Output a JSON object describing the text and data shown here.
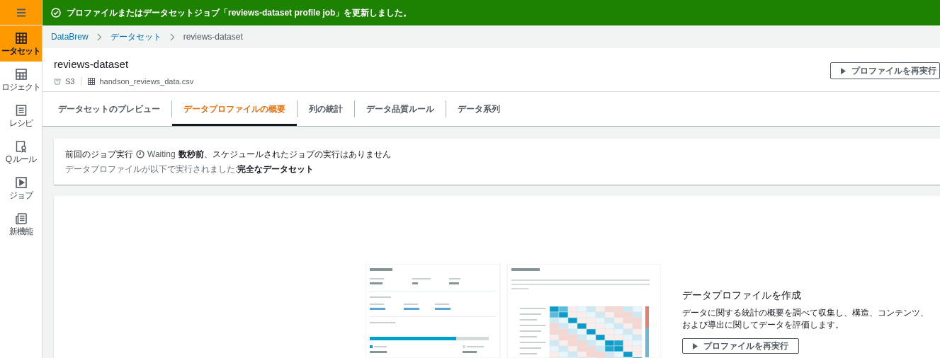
{
  "sidebar": {
    "items": [
      {
        "label": "ータセット",
        "selected": true
      },
      {
        "label": "ロジェクト",
        "selected": false
      },
      {
        "label": "レシピ",
        "selected": false
      },
      {
        "label": "Q ルール",
        "selected": false
      },
      {
        "label": "ジョブ",
        "selected": false
      },
      {
        "label": "新機能",
        "selected": false
      }
    ]
  },
  "flash": {
    "kind": "success",
    "message": "プロファイルまたはデータセットジョブ「reviews-dataset profile job」を更新しました。"
  },
  "breadcrumbs": [
    {
      "label": "DataBrew",
      "link": true
    },
    {
      "label": "データセット",
      "link": true
    },
    {
      "label": "reviews-dataset",
      "link": false
    }
  ],
  "header": {
    "title": "reviews-dataset",
    "source": "S3",
    "file": "handson_reviews_data.csv",
    "action": "プロファイルを再実行"
  },
  "tabs": [
    {
      "label": "データセットのプレビュー",
      "selected": false
    },
    {
      "label": "データプロファイルの概要",
      "selected": true
    },
    {
      "label": "列の統計",
      "selected": false
    },
    {
      "label": "データ品質ルール",
      "selected": false
    },
    {
      "label": "データ系列",
      "selected": false
    }
  ],
  "job_info": {
    "prefix": "前回のジョブ実行",
    "status": "Waiting",
    "time": "数秒前",
    "suffix": "、スケジュールされたジョブの実行はありません",
    "scope_text": "データプロファイルが以下で実行されました:**完全なデータセット**"
  },
  "cta": {
    "title": "データプロファイルを作成",
    "body": "データに関する統計の概要を調べて収集し、構造、コンテンツ、および導出に関してデータを評価します。",
    "button": "プロファイルを再実行"
  }
}
